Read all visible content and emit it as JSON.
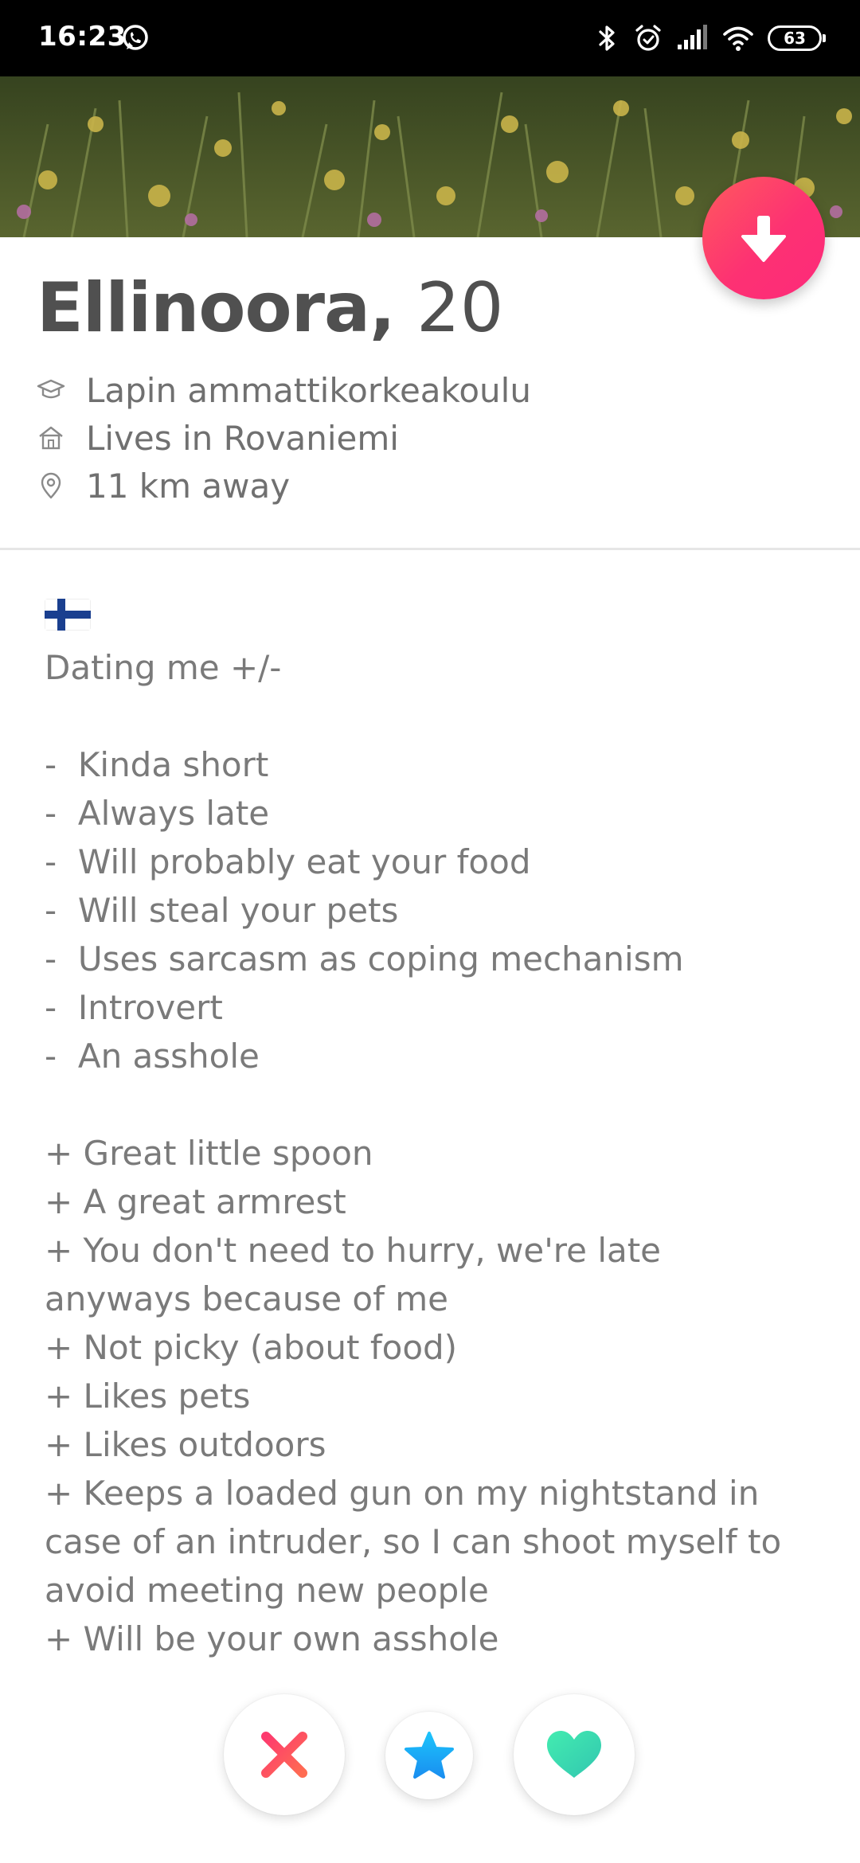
{
  "status_bar": {
    "time": "16:23",
    "battery": "63",
    "icons": [
      "whatsapp-icon",
      "bluetooth-icon",
      "alarm-icon",
      "signal-icon",
      "wifi-icon",
      "battery-icon"
    ]
  },
  "profile": {
    "name": "Ellinoora,",
    "age": "20",
    "school": "Lapin ammattikorkeakoulu",
    "lives_in": "Lives in Rovaniemi",
    "distance": "11 km away",
    "icons": {
      "school": "graduation-cap-icon",
      "home": "home-icon",
      "location": "location-pin-icon"
    }
  },
  "bio": {
    "flag": "finland-flag",
    "lines": [
      "Dating me +/-",
      "",
      "-  Kinda short",
      "-  Always late",
      "-  Will probably eat your food",
      "-  Will steal your pets",
      "-  Uses sarcasm as coping mechanism",
      "-  Introvert",
      "-  An asshole",
      "",
      "+ Great little spoon",
      "+ A great armrest",
      "+ You don't need to hurry, we're late",
      "anyways because of me",
      "+ Not picky (about food)",
      "+ Likes pets",
      "+ Likes outdoors",
      "+ Keeps a loaded gun on my nightstand in",
      "case of an intruder, so I can shoot myself to",
      "avoid meeting new people",
      "+ Will be your own asshole"
    ]
  },
  "actions": {
    "close_card": "arrow-down-icon",
    "nope": "x-icon",
    "super_like": "star-icon",
    "like": "heart-icon"
  },
  "colors": {
    "brand_gradient_start": "#fe5a5d",
    "brand_gradient_end": "#fd2a7a",
    "nope": "#fd4f62",
    "super_like": "#21a9f5",
    "like": "#3fe0ae",
    "text_primary": "#505050",
    "text_secondary": "#707070"
  }
}
